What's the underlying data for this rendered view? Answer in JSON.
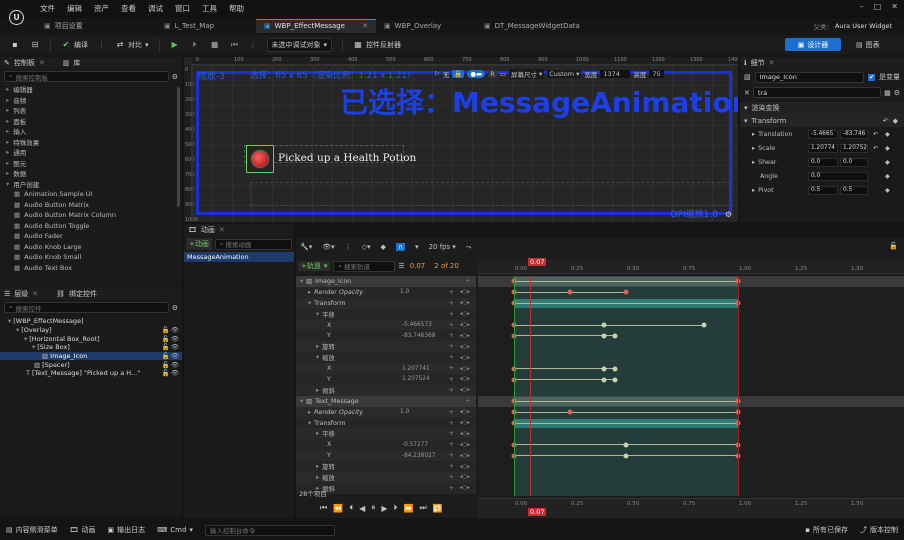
{
  "menu": [
    "文件",
    "编辑",
    "资产",
    "查看",
    "调试",
    "窗口",
    "工具",
    "帮助"
  ],
  "tabs": [
    {
      "label": "项目设置"
    },
    {
      "label": "L_Test_Map"
    },
    {
      "label": "WBP_EffectMessage"
    },
    {
      "label": "WBP_Overlay"
    },
    {
      "label": "DT_MessageWidgetData"
    }
  ],
  "window_right": {
    "prefix": "父类：",
    "parent": "Aura User Widget"
  },
  "toolbar": {
    "compile": "编译",
    "diff": "对比",
    "debug_target": "未选中调试对象",
    "reflector": "控件反射器",
    "designer": "设计器",
    "graph": "图表"
  },
  "palette": {
    "title": "控制板",
    "library": "库",
    "search_placeholder": "搜索控制板",
    "categories": [
      "编辑器",
      "音频",
      "列表",
      "面板",
      "输入",
      "特殊效果",
      "通用",
      "图元",
      "数据",
      "用户创建"
    ],
    "items": [
      "Animation Sample UI",
      "Audio Button Matrix",
      "Audio Button Matrix Column",
      "Audio Button Toggle",
      "Audio Fader",
      "Audio Knob Large",
      "Audio Knob Small",
      "Audio Text Box"
    ]
  },
  "hierarchy": {
    "title": "层级",
    "bind_tab": "绑定控件",
    "search_placeholder": "搜索控件",
    "items": [
      {
        "label": "[WBP_EffectMessage]",
        "depth": 0,
        "selected": false
      },
      {
        "label": "[Overlay]",
        "depth": 1,
        "selected": false
      },
      {
        "label": "[Horizontal Box_Root]",
        "depth": 2,
        "selected": false
      },
      {
        "label": "[Size Box]",
        "depth": 3,
        "selected": false
      },
      {
        "label": "Image_Icon",
        "depth": 4,
        "selected": true
      },
      {
        "label": "[Spacer]",
        "depth": 3,
        "selected": false
      },
      {
        "label": "[Text_Message] \"Picked up a H...\"",
        "depth": 2,
        "selected": false
      }
    ]
  },
  "canvas": {
    "zoom": "缩放-3",
    "selection_info": "选择：65 x 65（渲染比例：1.21 x 1.21）",
    "selected_banner": "已选择：MessageAnimation",
    "message_text": "Picked up a Health Potion",
    "dpi_label": "DPI缩放1.0",
    "none": "无",
    "screen_size": "屏幕尺寸",
    "custom": "Custom",
    "width_label": "宽度",
    "width_value": "1374",
    "height_label": "高度",
    "height_value": "75",
    "ruler_top": [
      "0",
      "100",
      "200",
      "300",
      "400",
      "500",
      "600",
      "700",
      "800",
      "900",
      "1000",
      "1100",
      "1200",
      "1300",
      "1400"
    ],
    "ruler_left": [
      "0",
      "100",
      "200",
      "300",
      "400",
      "500",
      "600",
      "700",
      "800",
      "900",
      "1000"
    ]
  },
  "details": {
    "title": "细节",
    "name": "Image_Icon",
    "is_variable": "是变量",
    "filter": "tra",
    "section": "渲染变换",
    "transform": "Transform",
    "translation": {
      "label": "Translation",
      "x": "-5.4665",
      "y": "-83.746"
    },
    "scale": {
      "label": "Scale",
      "x": "1.20774",
      "y": "1.20752"
    },
    "shear": {
      "label": "Shear",
      "x": "0.0",
      "y": "0.0"
    },
    "angle": {
      "label": "Angle",
      "value": "0.0"
    },
    "pivot": {
      "label": "Pivot",
      "x": "0.5",
      "y": "0.5"
    }
  },
  "animations": {
    "title": "动画",
    "add_label": "+动画",
    "search_placeholder": "搜索动画",
    "items": [
      "MessageAnimation"
    ]
  },
  "sequencer": {
    "add_track": "+轨道",
    "search_placeholder": "搜索轨道",
    "current_time": "0.07",
    "frame_info": "2 of 20",
    "fps": "20 fps",
    "item_count": "28个项目",
    "ruler_labels": [
      "0.00",
      "0.25",
      "0.50",
      "0.75",
      "1.00",
      "1.25",
      "1.50"
    ],
    "playhead": "0.07",
    "tracks": [
      {
        "label": "Image_Icon",
        "type": "header",
        "indent": 0
      },
      {
        "label": "Render Opacity",
        "type": "prop",
        "indent": 1,
        "value": "1.0"
      },
      {
        "label": "Transform",
        "type": "prop",
        "indent": 1,
        "value": ""
      },
      {
        "label": "平移",
        "type": "sub",
        "indent": 2,
        "value": ""
      },
      {
        "label": "X",
        "type": "val",
        "indent": 3,
        "value": "-5.466573"
      },
      {
        "label": "Y",
        "type": "val",
        "indent": 3,
        "value": "-83.746368"
      },
      {
        "label": "旋转",
        "type": "sub",
        "indent": 2,
        "value": ""
      },
      {
        "label": "缩放",
        "type": "sub",
        "indent": 2,
        "value": ""
      },
      {
        "label": "X",
        "type": "val",
        "indent": 3,
        "value": "1.207741"
      },
      {
        "label": "Y",
        "type": "val",
        "indent": 3,
        "value": "1.207524"
      },
      {
        "label": "倾斜",
        "type": "sub",
        "indent": 2,
        "value": ""
      },
      {
        "label": "Text_Message",
        "type": "header",
        "indent": 0
      },
      {
        "label": "Render Opacity",
        "type": "prop",
        "indent": 1,
        "value": "1.0"
      },
      {
        "label": "Transform",
        "type": "prop",
        "indent": 1,
        "value": ""
      },
      {
        "label": "平移",
        "type": "sub",
        "indent": 2,
        "value": ""
      },
      {
        "label": "X",
        "type": "val",
        "indent": 3,
        "value": "-0.57277"
      },
      {
        "label": "Y",
        "type": "val",
        "indent": 3,
        "value": "-84.238027"
      },
      {
        "label": "旋转",
        "type": "sub",
        "indent": 2,
        "value": ""
      },
      {
        "label": "缩放",
        "type": "sub",
        "indent": 2,
        "value": ""
      },
      {
        "label": "倾斜",
        "type": "sub",
        "indent": 2,
        "value": ""
      }
    ]
  },
  "statusbar": {
    "content_drawer": "内容侧滑菜单",
    "animation": "动画",
    "output_log": "输出日志",
    "cmd": "Cmd",
    "cmd_placeholder": "输入控制台命令",
    "save_all": "所有已保存",
    "source_control": "版本控制"
  }
}
